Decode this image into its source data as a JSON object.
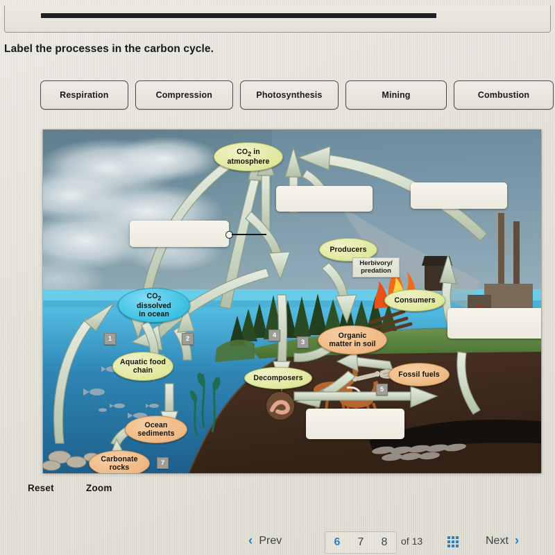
{
  "prompt": "Label the processes in the carbon cycle.",
  "word_bank": {
    "items": [
      {
        "label": "Respiration"
      },
      {
        "label": "Compression"
      },
      {
        "label": "Photosynthesis"
      },
      {
        "label": "Mining"
      },
      {
        "label": "Combustion"
      }
    ]
  },
  "diagram": {
    "title": "carbon-cycle-diagram",
    "nodes": [
      {
        "id": "co2-atmosphere",
        "label": "CO₂ in\natmosphere",
        "style": "green"
      },
      {
        "id": "co2-ocean",
        "label": "CO₂\ndissolved\nin ocean",
        "style": "cyan"
      },
      {
        "id": "producers",
        "label": "Producers",
        "style": "green"
      },
      {
        "id": "consumers",
        "label": "Consumers",
        "style": "green"
      },
      {
        "id": "aquatic-food-chain",
        "label": "Aquatic food\nchain",
        "style": "green"
      },
      {
        "id": "decomposers",
        "label": "Decomposers",
        "style": "green"
      },
      {
        "id": "organic-matter",
        "label": "Organic\nmatter in soil",
        "style": "orange"
      },
      {
        "id": "fossil-fuels",
        "label": "Fossil fuels",
        "style": "orange"
      },
      {
        "id": "ocean-sediments",
        "label": "Ocean\nsediments",
        "style": "orange"
      },
      {
        "id": "carbonate-rocks",
        "label": "Carbonate\nrocks",
        "style": "orange"
      }
    ],
    "sub_labels": [
      {
        "id": "herbivory-predation",
        "label": "Herbivory/\npredation"
      }
    ],
    "badges": [
      "1",
      "2",
      "3",
      "4",
      "5",
      "7"
    ],
    "drop_boxes": [
      {
        "id": "drop-ocean-exchange",
        "value": ""
      },
      {
        "id": "drop-photosynthesis",
        "value": ""
      },
      {
        "id": "drop-combustion",
        "value": ""
      },
      {
        "id": "drop-mining",
        "value": ""
      },
      {
        "id": "drop-compression",
        "value": ""
      }
    ]
  },
  "controls": {
    "reset_label": "Reset",
    "zoom_label": "Zoom"
  },
  "nav": {
    "prev_label": "Prev",
    "next_label": "Next",
    "prev_chevron": "‹",
    "next_chevron": "›",
    "link_icon": "∞",
    "pages": [
      "6",
      "7",
      "8"
    ],
    "active_page": "6",
    "of_text": "of 13"
  }
}
